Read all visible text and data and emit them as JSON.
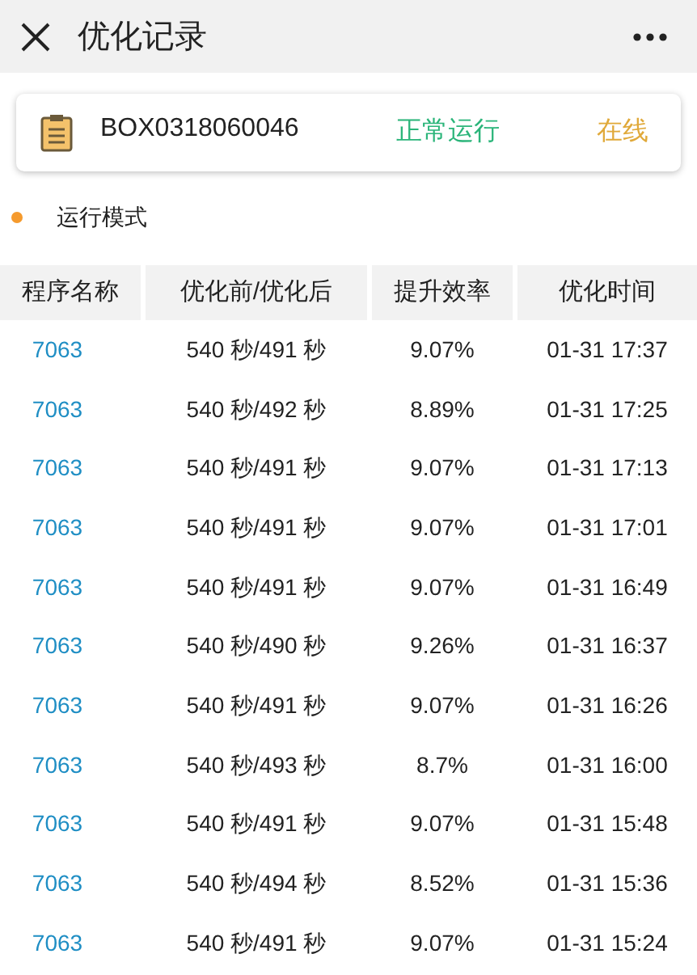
{
  "header": {
    "title": "优化记录"
  },
  "device": {
    "id": "BOX0318060046",
    "status": "正常运行",
    "connection": "在线"
  },
  "section": {
    "title": "运行模式"
  },
  "table": {
    "columns": [
      "程序名称",
      "优化前/优化后",
      "提升效率",
      "优化时间"
    ],
    "rows": [
      [
        "7063",
        "540 秒/491 秒",
        "9.07%",
        "01-31 17:37"
      ],
      [
        "7063",
        "540 秒/492 秒",
        "8.89%",
        "01-31 17:25"
      ],
      [
        "7063",
        "540 秒/491 秒",
        "9.07%",
        "01-31 17:13"
      ],
      [
        "7063",
        "540 秒/491 秒",
        "9.07%",
        "01-31 17:01"
      ],
      [
        "7063",
        "540 秒/491 秒",
        "9.07%",
        "01-31 16:49"
      ],
      [
        "7063",
        "540 秒/490 秒",
        "9.26%",
        "01-31 16:37"
      ],
      [
        "7063",
        "540 秒/491 秒",
        "9.07%",
        "01-31 16:26"
      ],
      [
        "7063",
        "540 秒/493 秒",
        "8.7%",
        "01-31 16:00"
      ],
      [
        "7063",
        "540 秒/491 秒",
        "9.07%",
        "01-31 15:48"
      ],
      [
        "7063",
        "540 秒/494 秒",
        "8.52%",
        "01-31 15:36"
      ],
      [
        "7063",
        "540 秒/491 秒",
        "9.07%",
        "01-31 15:24"
      ]
    ]
  }
}
